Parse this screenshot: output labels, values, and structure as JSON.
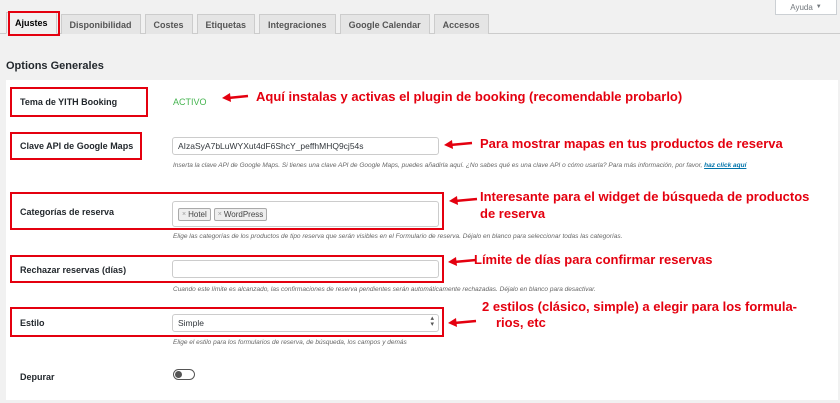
{
  "help": {
    "label": "Ayuda",
    "caret": "▼"
  },
  "tabs": [
    {
      "label": "Ajustes",
      "active": true
    },
    {
      "label": "Disponibilidad"
    },
    {
      "label": "Costes"
    },
    {
      "label": "Etiquetas"
    },
    {
      "label": "Integraciones"
    },
    {
      "label": "Google Calendar"
    },
    {
      "label": "Accesos"
    }
  ],
  "section_title": "Options Generales",
  "settings": {
    "theme": {
      "label": "Tema de YITH Booking",
      "value": "ACTIVO",
      "value_color": "#46b450"
    },
    "maps": {
      "label": "Clave API de Google Maps",
      "value": "AIzaSyA7bLuWYXut4dF6ShcY_peffhMHQ9cj54s",
      "desc": "Inserta la clave API de Google Maps. Si tienes una clave API de Google Maps, puedes añadirla aquí. ¿No sabes qué es una clave API o cómo usarla? Para más información, por favor,",
      "link": "haz click aquí"
    },
    "categories": {
      "label": "Categorías de reserva",
      "chips": [
        "Hotel",
        "WordPress"
      ],
      "chip_remove": "×",
      "desc": "Elige las categorías de los productos de tipo reserva que serán visibles en el Formulario de reserva. Déjalo en blanco para seleccionar todas las categorías."
    },
    "reject": {
      "label": "Rechazar reservas (días)",
      "value": "",
      "desc": "Cuando este límite es alcanzado, las confirmaciones de reserva pendientes serán automáticamente rechazadas. Déjalo en blanco para desactivar."
    },
    "style": {
      "label": "Estilo",
      "value": "Simple",
      "desc": "Elige el estilo para los formularios de reserva, de búsqueda, los campos y demás"
    },
    "debug": {
      "label": "Depurar",
      "enabled": false
    }
  },
  "annotations": {
    "a1": "Aquí instalas y activas el plugin de booking (recomendable probarlo)",
    "a2": "Para mostrar mapas en tus productos de reserva",
    "a3_l1": "Interesante para el widget de búsqueda de productos",
    "a3_l2": "de reserva",
    "a4": "Límite de días para confirmar reservas",
    "a5_l1": "2 estilos (clásico, simple) a elegir para los formula-",
    "a5_l2": "rios, etc"
  },
  "colors": {
    "annotation": "#e4000f",
    "link": "#0073aa"
  }
}
